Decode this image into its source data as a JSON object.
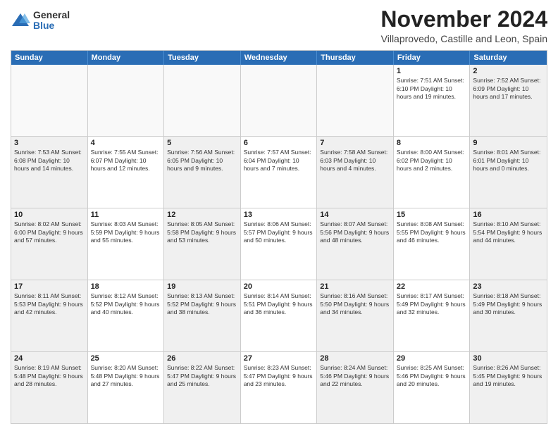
{
  "logo": {
    "general": "General",
    "blue": "Blue"
  },
  "title": "November 2024",
  "location": "Villaprovedo, Castille and Leon, Spain",
  "header": {
    "days": [
      "Sunday",
      "Monday",
      "Tuesday",
      "Wednesday",
      "Thursday",
      "Friday",
      "Saturday"
    ]
  },
  "weeks": [
    [
      {
        "day": "",
        "empty": true,
        "text": ""
      },
      {
        "day": "",
        "empty": true,
        "text": ""
      },
      {
        "day": "",
        "empty": true,
        "text": ""
      },
      {
        "day": "",
        "empty": true,
        "text": ""
      },
      {
        "day": "",
        "empty": true,
        "text": ""
      },
      {
        "day": "1",
        "text": "Sunrise: 7:51 AM\nSunset: 6:10 PM\nDaylight: 10 hours\nand 19 minutes."
      },
      {
        "day": "2",
        "text": "Sunrise: 7:52 AM\nSunset: 6:09 PM\nDaylight: 10 hours\nand 17 minutes."
      }
    ],
    [
      {
        "day": "3",
        "text": "Sunrise: 7:53 AM\nSunset: 6:08 PM\nDaylight: 10 hours\nand 14 minutes."
      },
      {
        "day": "4",
        "text": "Sunrise: 7:55 AM\nSunset: 6:07 PM\nDaylight: 10 hours\nand 12 minutes."
      },
      {
        "day": "5",
        "text": "Sunrise: 7:56 AM\nSunset: 6:05 PM\nDaylight: 10 hours\nand 9 minutes."
      },
      {
        "day": "6",
        "text": "Sunrise: 7:57 AM\nSunset: 6:04 PM\nDaylight: 10 hours\nand 7 minutes."
      },
      {
        "day": "7",
        "text": "Sunrise: 7:58 AM\nSunset: 6:03 PM\nDaylight: 10 hours\nand 4 minutes."
      },
      {
        "day": "8",
        "text": "Sunrise: 8:00 AM\nSunset: 6:02 PM\nDaylight: 10 hours\nand 2 minutes."
      },
      {
        "day": "9",
        "text": "Sunrise: 8:01 AM\nSunset: 6:01 PM\nDaylight: 10 hours\nand 0 minutes."
      }
    ],
    [
      {
        "day": "10",
        "text": "Sunrise: 8:02 AM\nSunset: 6:00 PM\nDaylight: 9 hours\nand 57 minutes."
      },
      {
        "day": "11",
        "text": "Sunrise: 8:03 AM\nSunset: 5:59 PM\nDaylight: 9 hours\nand 55 minutes."
      },
      {
        "day": "12",
        "text": "Sunrise: 8:05 AM\nSunset: 5:58 PM\nDaylight: 9 hours\nand 53 minutes."
      },
      {
        "day": "13",
        "text": "Sunrise: 8:06 AM\nSunset: 5:57 PM\nDaylight: 9 hours\nand 50 minutes."
      },
      {
        "day": "14",
        "text": "Sunrise: 8:07 AM\nSunset: 5:56 PM\nDaylight: 9 hours\nand 48 minutes."
      },
      {
        "day": "15",
        "text": "Sunrise: 8:08 AM\nSunset: 5:55 PM\nDaylight: 9 hours\nand 46 minutes."
      },
      {
        "day": "16",
        "text": "Sunrise: 8:10 AM\nSunset: 5:54 PM\nDaylight: 9 hours\nand 44 minutes."
      }
    ],
    [
      {
        "day": "17",
        "text": "Sunrise: 8:11 AM\nSunset: 5:53 PM\nDaylight: 9 hours\nand 42 minutes."
      },
      {
        "day": "18",
        "text": "Sunrise: 8:12 AM\nSunset: 5:52 PM\nDaylight: 9 hours\nand 40 minutes."
      },
      {
        "day": "19",
        "text": "Sunrise: 8:13 AM\nSunset: 5:52 PM\nDaylight: 9 hours\nand 38 minutes."
      },
      {
        "day": "20",
        "text": "Sunrise: 8:14 AM\nSunset: 5:51 PM\nDaylight: 9 hours\nand 36 minutes."
      },
      {
        "day": "21",
        "text": "Sunrise: 8:16 AM\nSunset: 5:50 PM\nDaylight: 9 hours\nand 34 minutes."
      },
      {
        "day": "22",
        "text": "Sunrise: 8:17 AM\nSunset: 5:49 PM\nDaylight: 9 hours\nand 32 minutes."
      },
      {
        "day": "23",
        "text": "Sunrise: 8:18 AM\nSunset: 5:49 PM\nDaylight: 9 hours\nand 30 minutes."
      }
    ],
    [
      {
        "day": "24",
        "text": "Sunrise: 8:19 AM\nSunset: 5:48 PM\nDaylight: 9 hours\nand 28 minutes."
      },
      {
        "day": "25",
        "text": "Sunrise: 8:20 AM\nSunset: 5:48 PM\nDaylight: 9 hours\nand 27 minutes."
      },
      {
        "day": "26",
        "text": "Sunrise: 8:22 AM\nSunset: 5:47 PM\nDaylight: 9 hours\nand 25 minutes."
      },
      {
        "day": "27",
        "text": "Sunrise: 8:23 AM\nSunset: 5:47 PM\nDaylight: 9 hours\nand 23 minutes."
      },
      {
        "day": "28",
        "text": "Sunrise: 8:24 AM\nSunset: 5:46 PM\nDaylight: 9 hours\nand 22 minutes."
      },
      {
        "day": "29",
        "text": "Sunrise: 8:25 AM\nSunset: 5:46 PM\nDaylight: 9 hours\nand 20 minutes."
      },
      {
        "day": "30",
        "text": "Sunrise: 8:26 AM\nSunset: 5:45 PM\nDaylight: 9 hours\nand 19 minutes."
      }
    ]
  ]
}
